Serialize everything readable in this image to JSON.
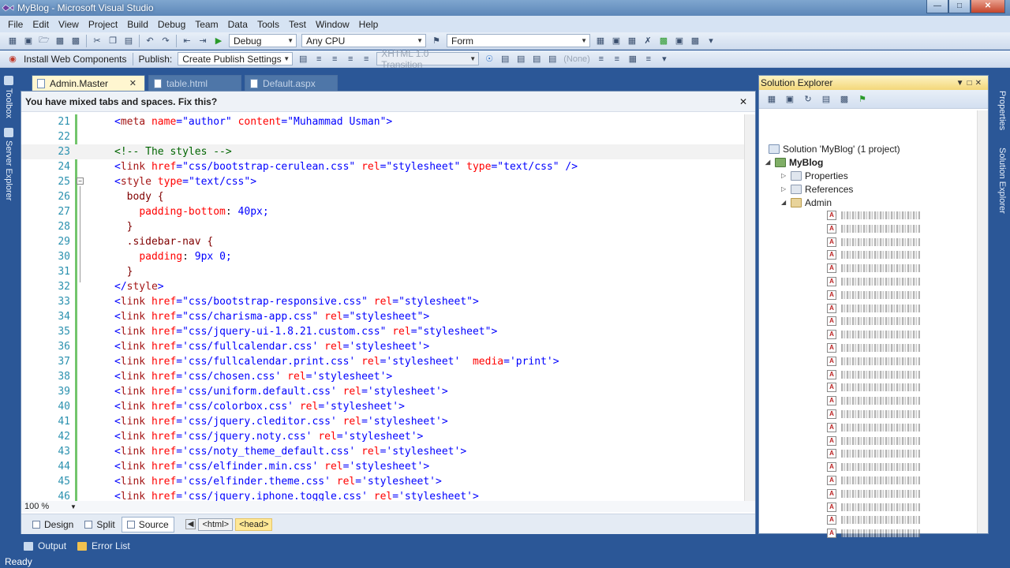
{
  "window": {
    "title": "MyBlog - Microsoft Visual Studio"
  },
  "menu": [
    "File",
    "Edit",
    "View",
    "Project",
    "Build",
    "Debug",
    "Team",
    "Data",
    "Tools",
    "Test",
    "Window",
    "Help"
  ],
  "toolbar1": {
    "config": "Debug",
    "platform": "Any CPU",
    "find": "Form"
  },
  "toolbar2": {
    "install_web_components": "Install Web Components",
    "publish_label": "Publish:",
    "publish_settings": "Create Publish Settings",
    "doctype": "XHTML 1.0 Transition",
    "style_label": "(None)"
  },
  "side_tabs": {
    "toolbox": "Toolbox",
    "server_explorer": "Server Explorer"
  },
  "editor_tabs": [
    {
      "label": "Admin.Master",
      "active": true
    },
    {
      "label": "table.html",
      "active": false
    },
    {
      "label": "Default.aspx",
      "active": false
    }
  ],
  "infobar": {
    "message": "You have mixed tabs and spaces. Fix this?"
  },
  "code": [
    {
      "n": "21",
      "text": "<meta name=\"author\" content=\"Muhammad Usman\">"
    },
    {
      "n": "22",
      "text": ""
    },
    {
      "n": "23",
      "text": "<!-- The styles -->"
    },
    {
      "n": "24",
      "text": "<link href=\"css/bootstrap-cerulean.css\" rel=\"stylesheet\" type=\"text/css\" />"
    },
    {
      "n": "25",
      "text": "<style type=\"text/css\">"
    },
    {
      "n": "26",
      "text": "  body {"
    },
    {
      "n": "27",
      "text": "    padding-bottom: 40px;"
    },
    {
      "n": "28",
      "text": "  }"
    },
    {
      "n": "29",
      "text": "  .sidebar-nav {"
    },
    {
      "n": "30",
      "text": "    padding: 9px 0;"
    },
    {
      "n": "31",
      "text": "  }"
    },
    {
      "n": "32",
      "text": "</style>"
    },
    {
      "n": "33",
      "text": "<link href=\"css/bootstrap-responsive.css\" rel=\"stylesheet\">"
    },
    {
      "n": "34",
      "text": "<link href=\"css/charisma-app.css\" rel=\"stylesheet\">"
    },
    {
      "n": "35",
      "text": "<link href=\"css/jquery-ui-1.8.21.custom.css\" rel=\"stylesheet\">"
    },
    {
      "n": "36",
      "text": "<link href='css/fullcalendar.css' rel='stylesheet'>"
    },
    {
      "n": "37",
      "text": "<link href='css/fullcalendar.print.css' rel='stylesheet'  media='print'>"
    },
    {
      "n": "38",
      "text": "<link href='css/chosen.css' rel='stylesheet'>"
    },
    {
      "n": "39",
      "text": "<link href='css/uniform.default.css' rel='stylesheet'>"
    },
    {
      "n": "40",
      "text": "<link href='css/colorbox.css' rel='stylesheet'>"
    },
    {
      "n": "41",
      "text": "<link href='css/jquery.cleditor.css' rel='stylesheet'>"
    },
    {
      "n": "42",
      "text": "<link href='css/jquery.noty.css' rel='stylesheet'>"
    },
    {
      "n": "43",
      "text": "<link href='css/noty_theme_default.css' rel='stylesheet'>"
    },
    {
      "n": "44",
      "text": "<link href='css/elfinder.min.css' rel='stylesheet'>"
    },
    {
      "n": "45",
      "text": "<link href='css/elfinder.theme.css' rel='stylesheet'>"
    },
    {
      "n": "46",
      "text": "<link href='css/jquery.iphone.toggle.css' rel='stylesheet'>"
    }
  ],
  "zoom": "100 %",
  "view_bar": {
    "design": "Design",
    "split": "Split",
    "source": "Source",
    "crumb_html": "<html>",
    "crumb_head": "<head>"
  },
  "solution_explorer": {
    "title": "Solution Explorer",
    "solution": "Solution 'MyBlog' (1 project)",
    "project": "MyBlog",
    "properties": "Properties",
    "references": "References",
    "admin": "Admin"
  },
  "right_tabs": {
    "properties": "Properties",
    "solution_explorer": "Solution Explorer"
  },
  "bottom_tabs": {
    "output": "Output",
    "error_list": "Error List"
  },
  "status": {
    "text": "Ready"
  }
}
